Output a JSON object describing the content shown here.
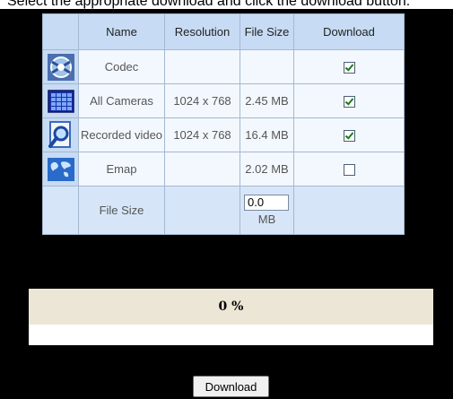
{
  "instruction": "Select the appropriate download and click the download button.",
  "table": {
    "headers": {
      "name": "Name",
      "resolution": "Resolution",
      "file_size": "File Size",
      "download": "Download"
    },
    "rows": [
      {
        "icon": "codec-icon",
        "name": "Codec",
        "resolution": "",
        "file_size": "",
        "download": true
      },
      {
        "icon": "cameras-grid-icon",
        "name": "All Cameras",
        "resolution": "1024 x 768",
        "file_size": "2.45 MB",
        "download": true
      },
      {
        "icon": "recorded-video-icon",
        "name": "Recorded video",
        "resolution": "1024 x 768",
        "file_size": "16.4 MB",
        "download": true
      },
      {
        "icon": "emap-icon",
        "name": "Emap",
        "resolution": "",
        "file_size": "2.02 MB",
        "download": false
      }
    ],
    "total": {
      "label": "File Size",
      "value": "0.0",
      "unit": "MB"
    }
  },
  "progress": {
    "text": "0 %",
    "fraction": 0
  },
  "download_button": "Download",
  "colors": {
    "header_bg": "#c8dbf4",
    "cell_bg": "#f3f8fe",
    "progress_bg": "#ebe6d6"
  }
}
